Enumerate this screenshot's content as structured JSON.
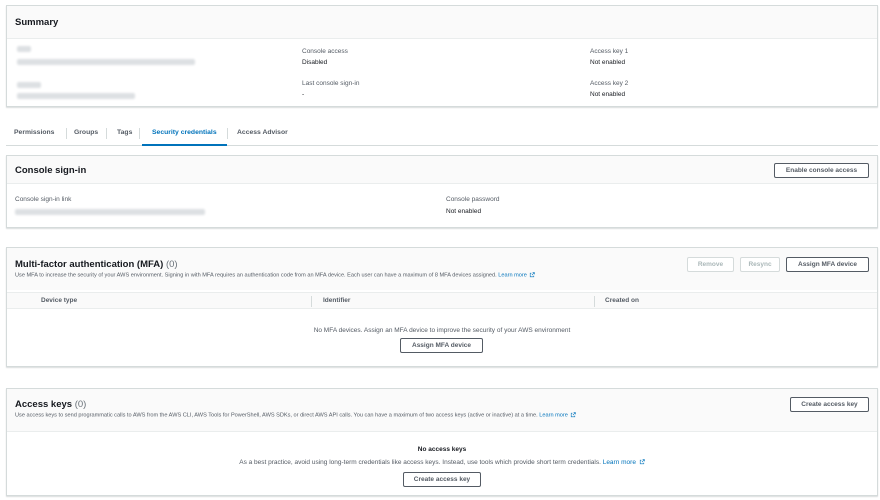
{
  "summary": {
    "title": "Summary",
    "console_access_label": "Console access",
    "console_access_value": "Disabled",
    "last_signin_label": "Last console sign-in",
    "last_signin_value": "-",
    "access_key1_label": "Access key 1",
    "access_key1_value": "Not enabled",
    "access_key2_label": "Access key 2",
    "access_key2_value": "Not enabled"
  },
  "tabs": [
    "Permissions",
    "Groups",
    "Tags",
    "Security credentials",
    "Access Advisor"
  ],
  "console_signin": {
    "title": "Console sign-in",
    "enable_button": "Enable console access",
    "link_label": "Console sign-in link",
    "password_label": "Console password",
    "password_value": "Not enabled"
  },
  "mfa": {
    "title": "Multi-factor authentication (MFA)",
    "count": "(0)",
    "description": "Use MFA to increase the security of your AWS environment. Signing in with MFA requires an authentication code from an MFA device. Each user can have a maximum of 8 MFA devices assigned.",
    "learn_more": "Learn more",
    "remove_button": "Remove",
    "resync_button": "Resync",
    "assign_button": "Assign MFA device",
    "columns": [
      "Device type",
      "Identifier",
      "Created on"
    ],
    "empty_text": "No MFA devices. Assign an MFA device to improve the security of your AWS environment",
    "empty_assign_button": "Assign MFA device"
  },
  "access_keys": {
    "title": "Access keys",
    "count": "(0)",
    "description": "Use access keys to send programmatic calls to AWS from the AWS CLI, AWS Tools for PowerShell, AWS SDKs, or direct AWS API calls. You can have a maximum of two access keys (active or inactive) at a time.",
    "learn_more": "Learn more",
    "create_button": "Create access key",
    "empty_title": "No access keys",
    "empty_text": "As a best practice, avoid using long-term credentials like access keys. Instead, use tools which provide short term credentials.",
    "empty_learn_more": "Learn more",
    "empty_create_button": "Create access key"
  }
}
